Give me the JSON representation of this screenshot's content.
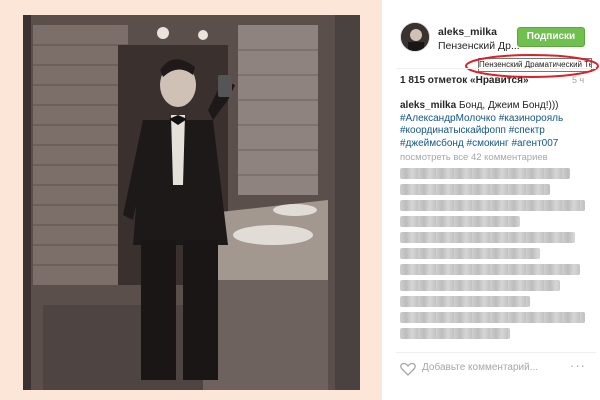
{
  "post": {
    "username": "aleks_milka",
    "location": "Пензенский Др...",
    "follow_label": "Подписки",
    "location_tooltip": "Пензенский Драматический Театр",
    "likes": "1 815 отметок «Нравится»",
    "time": "5 ч",
    "caption_username": "aleks_milka",
    "caption_text": " Бонд, Джеим Бонд!)))",
    "hashtags": [
      "#АлександрМолочко #казинорояль",
      "#координатыскайфопп #спектр",
      "#джеймсбонд #смокинг #агент007"
    ],
    "view_all_comments": "посмотреть все 42 комментариев",
    "comment_placeholder": "Добавьте комментарий...",
    "more_glyph": "···"
  },
  "colors": {
    "follow_bg": "#70c050",
    "link": "#125688",
    "highlight_ellipse": "#d9232a",
    "media_bg": "#fbe6d8"
  },
  "icons": {
    "like": "heart-outline-icon",
    "more": "more-options-icon"
  }
}
